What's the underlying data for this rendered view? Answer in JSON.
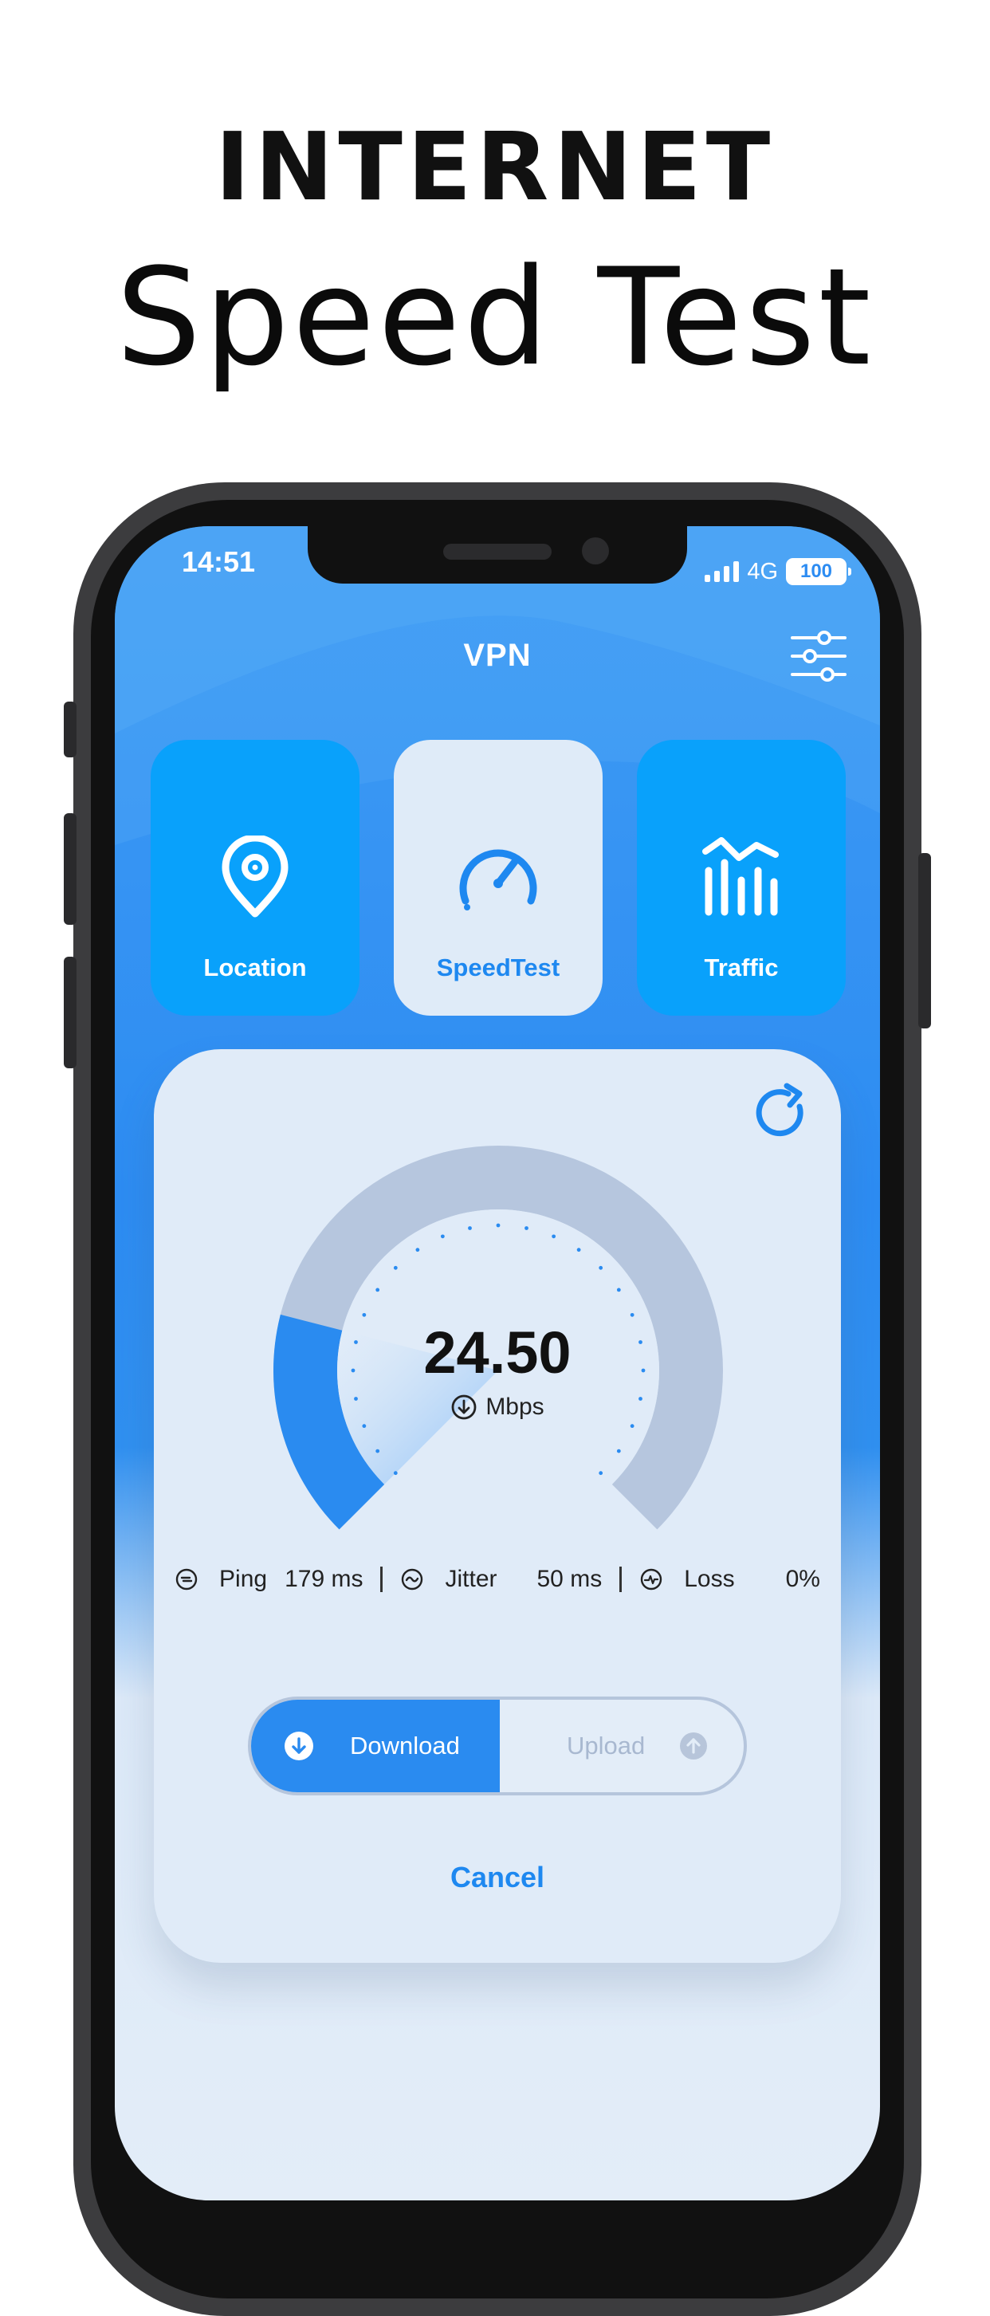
{
  "hero": {
    "line1": "INTERNET",
    "line2": "Speed Test"
  },
  "status_bar": {
    "time": "14:51",
    "network": "4G",
    "battery": "100"
  },
  "app": {
    "title": "VPN"
  },
  "tiles": [
    {
      "label": "Location",
      "icon": "location-pin-icon"
    },
    {
      "label": "SpeedTest",
      "icon": "speedometer-icon",
      "active": true
    },
    {
      "label": "Traffic",
      "icon": "traffic-chart-icon"
    }
  ],
  "speed": {
    "value": "24.50",
    "unit": "Mbps",
    "gauge_fraction": 0.22
  },
  "stats": {
    "ping": {
      "label": "Ping",
      "value": "179 ms"
    },
    "jitter": {
      "label": "Jitter",
      "value": "50 ms"
    },
    "loss": {
      "label": "Loss",
      "value": "0%"
    }
  },
  "mode_toggle": {
    "download": "Download",
    "upload": "Upload",
    "selected": "Download"
  },
  "cancel_label": "Cancel",
  "colors": {
    "accent": "#2a8bf0",
    "tile_blue": "#09a1fb",
    "card_bg": "#e0ebf8",
    "gauge_track": "#b6c6de"
  }
}
